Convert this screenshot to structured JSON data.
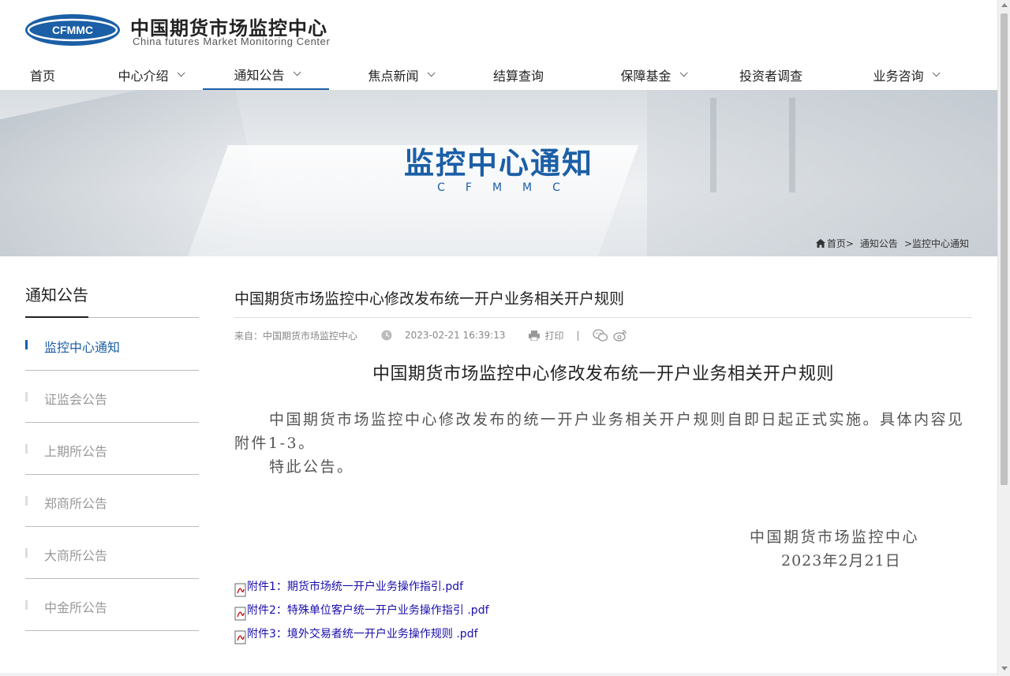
{
  "header": {
    "logo_text": "CFMMC",
    "site_title": "中国期货市场监控中心",
    "site_subtitle": "China futures Market Monitoring Center"
  },
  "nav": [
    {
      "label": "首页",
      "dropdown": false,
      "active": false
    },
    {
      "label": "中心介绍",
      "dropdown": true,
      "active": false
    },
    {
      "label": "通知公告",
      "dropdown": true,
      "active": true
    },
    {
      "label": "焦点新闻",
      "dropdown": true,
      "active": false
    },
    {
      "label": "结算查询",
      "dropdown": false,
      "active": false
    },
    {
      "label": "保障基金",
      "dropdown": true,
      "active": false
    },
    {
      "label": "投资者调查",
      "dropdown": false,
      "active": false
    },
    {
      "label": "业务咨询",
      "dropdown": true,
      "active": false
    }
  ],
  "banner": {
    "title": "监控中心通知",
    "subtitle": "CFMMC"
  },
  "breadcrumb": {
    "home": "首页>",
    "level1": "通知公告",
    "level2": ">监控中心通知"
  },
  "sidebar": {
    "title": "通知公告",
    "items": [
      {
        "label": "监控中心通知",
        "active": true
      },
      {
        "label": "证监会公告",
        "active": false
      },
      {
        "label": "上期所公告",
        "active": false
      },
      {
        "label": "郑商所公告",
        "active": false
      },
      {
        "label": "大商所公告",
        "active": false
      },
      {
        "label": "中金所公告",
        "active": false
      }
    ]
  },
  "article": {
    "title": "中国期货市场监控中心修改发布统一开户业务相关开户规则",
    "source": "来自：中国期货市场监控中心",
    "datetime": "2023-02-21 16:39:13",
    "print_label": "打印",
    "separator": "|",
    "heading": "中国期货市场监控中心修改发布统一开户业务相关开户规则",
    "paragraph1": "中国期货市场监控中心修改发布的统一开户业务相关开户规则自即日起正式实施。具体内容见附件1-3。",
    "paragraph2": "特此公告。",
    "signature_org": "中国期货市场监控中心",
    "signature_date": "2023年2月21日",
    "attachments": [
      "附件1：期货市场统一开户业务操作指引.pdf",
      "附件2：特殊单位客户统一开户业务操作指引 .pdf",
      "附件3：境外交易者统一开户业务操作规则 .pdf"
    ]
  },
  "colors": {
    "brand_blue": "#1b5fa6",
    "link_blue": "#1a0dab"
  },
  "icons": {
    "clock": "clock-icon",
    "print": "printer-icon",
    "wechat": "wechat-icon",
    "weibo": "weibo-icon",
    "home": "home-icon",
    "pdf": "pdf-icon"
  }
}
